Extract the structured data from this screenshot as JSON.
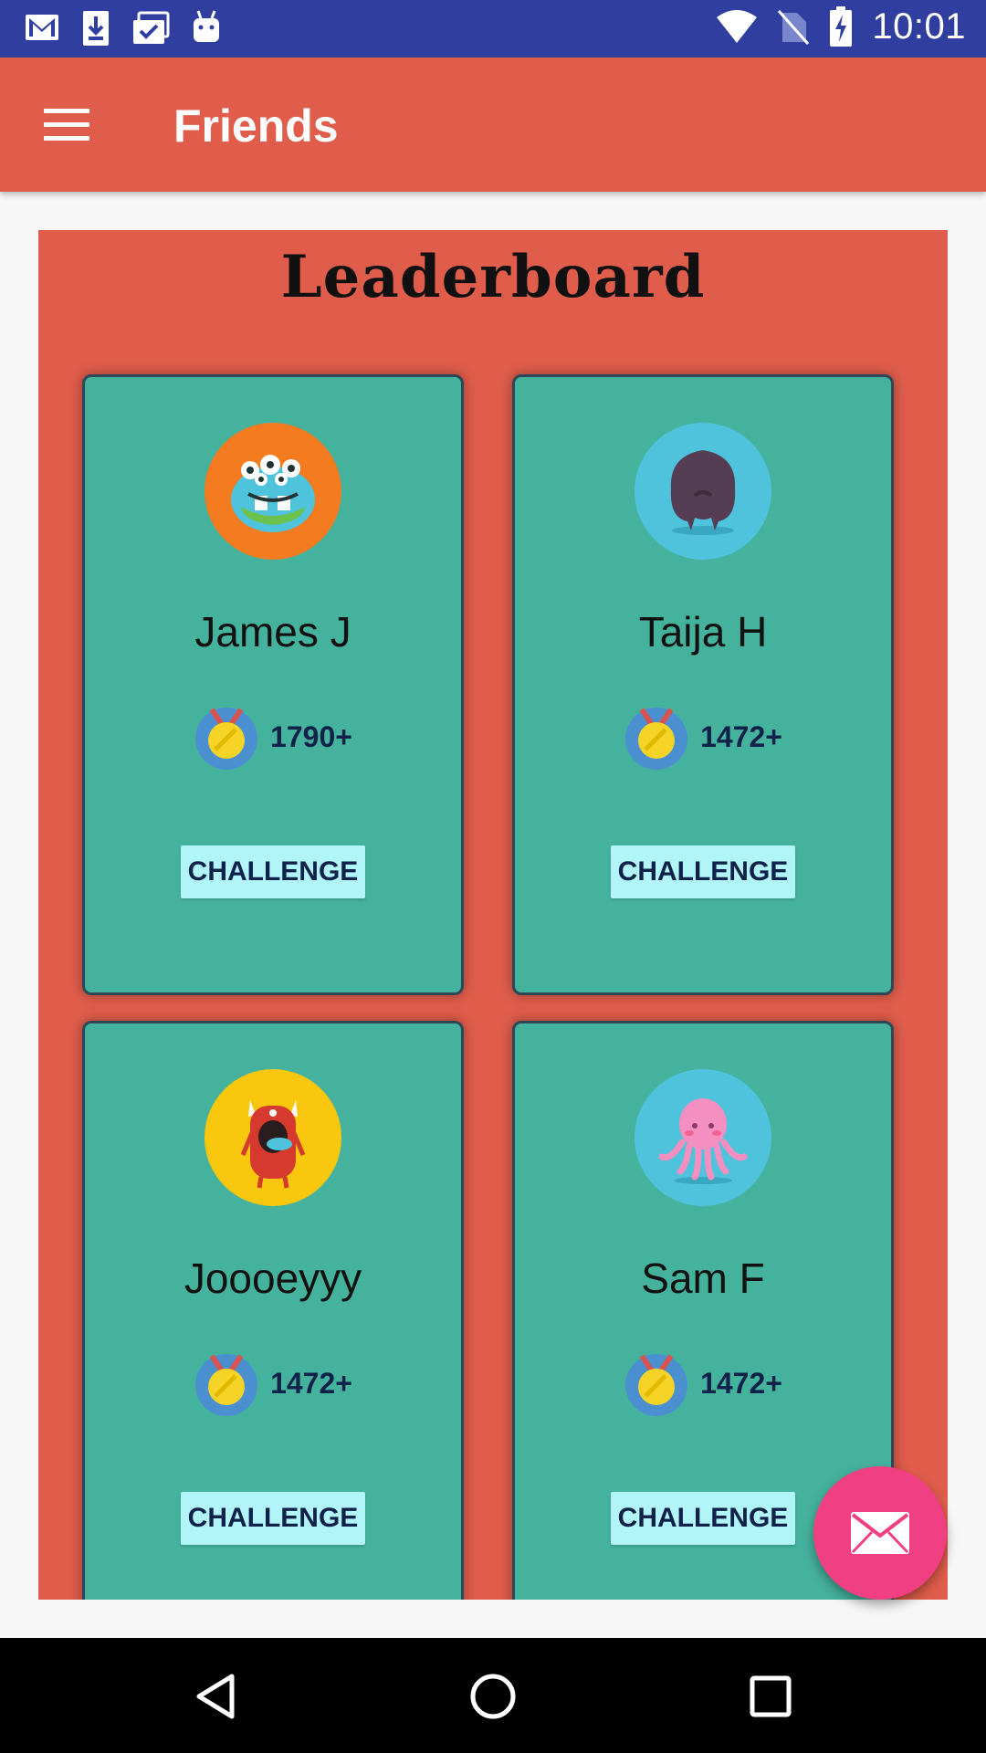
{
  "status_bar": {
    "time": "10:01",
    "left_icons": [
      "gmail-icon",
      "download-icon",
      "task-icon",
      "android-icon"
    ],
    "right_icons": [
      "wifi-icon",
      "no-sim-icon",
      "battery-charging-icon"
    ]
  },
  "app_bar": {
    "title": "Friends",
    "menu_icon": "hamburger-menu-icon",
    "color": "#e05d4b"
  },
  "leaderboard": {
    "title": "Leaderboard",
    "friends": [
      {
        "name": "James J",
        "score": "1790+",
        "button": "CHALLENGE",
        "avatar": "orange-many-eyed-monster-avatar",
        "avatar_bg": "#f47b20"
      },
      {
        "name": "Taija H",
        "score": "1472+",
        "button": "CHALLENGE",
        "avatar": "furry-dark-monster-avatar",
        "avatar_bg": "#4fc3dc"
      },
      {
        "name": "Joooeyyy",
        "score": "1472+",
        "button": "CHALLENGE",
        "avatar": "red-horned-monster-avatar",
        "avatar_bg": "#f9c80e"
      },
      {
        "name": "Sam F",
        "score": "1472+",
        "button": "CHALLENGE",
        "avatar": "pink-octopus-avatar",
        "avatar_bg": "#4fc3dc"
      }
    ]
  },
  "fab": {
    "icon": "envelope-icon",
    "color": "#f13f83"
  },
  "nav_bar": {
    "icons": [
      "back-icon",
      "home-icon",
      "recents-icon"
    ]
  }
}
